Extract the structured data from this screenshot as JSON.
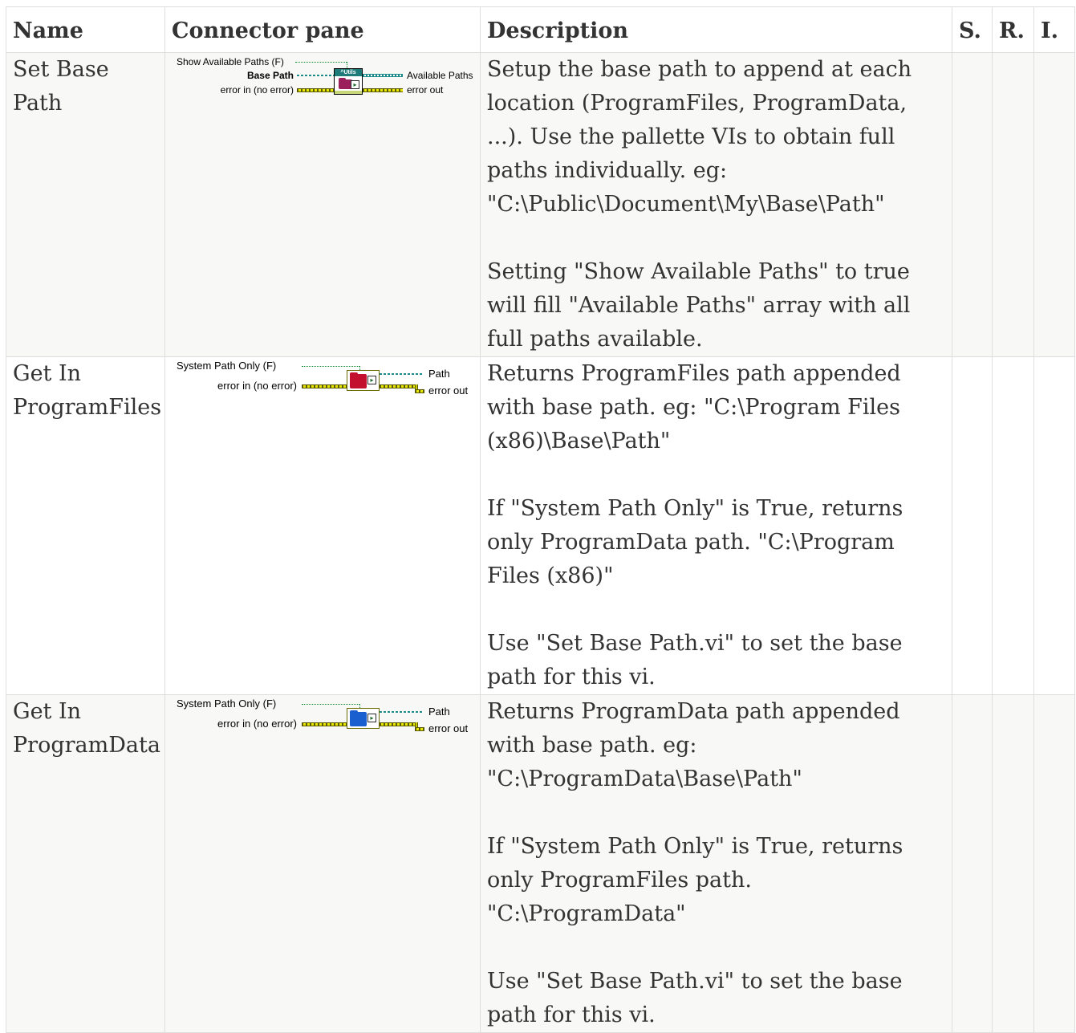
{
  "table": {
    "headers": {
      "name": "Name",
      "connector": "Connector pane",
      "description": "Description",
      "s": "S.",
      "r": "R.",
      "i": "I."
    },
    "rows": [
      {
        "name": "Set Base Path",
        "connector": {
          "icon_banner": "^Utils",
          "icon_color": "#9b1f5a",
          "inputs": [
            "Show Available Paths (F)",
            "Base Path",
            "error in (no error)"
          ],
          "outputs": [
            "Available Paths",
            "error out"
          ]
        },
        "description": {
          "p1": "Setup the base path to append at each location (ProgramFiles, ProgramData, ...). Use the pallette VIs to obtain full paths individually. eg: \"C:\\Public\\Document\\My\\Base\\Path\"",
          "p2": "Setting \"Show Available Paths\" to true will fill \"Available Paths\" array with all full paths available."
        },
        "s": "",
        "r": "",
        "i": ""
      },
      {
        "name": "Get In ProgramFiles",
        "connector": {
          "icon_color": "#c4102f",
          "inputs": [
            "System Path Only (F)",
            "error in (no error)"
          ],
          "outputs": [
            "Path",
            "error out"
          ]
        },
        "description": {
          "p1": "Returns ProgramFiles path appended with base path. eg: \"C:\\Program Files (x86)\\Base\\Path\"",
          "p2": "If \"System Path Only\" is True, returns only ProgramData path. \"C:\\Program Files (x86)\"",
          "p3": "Use \"Set Base Path.vi\" to set the base path for this vi."
        },
        "s": "",
        "r": "",
        "i": ""
      },
      {
        "name": "Get In ProgramData",
        "connector": {
          "icon_color": "#1a5fd0",
          "inputs": [
            "System Path Only (F)",
            "error in (no error)"
          ],
          "outputs": [
            "Path",
            "error out"
          ]
        },
        "description": {
          "p1": "Returns ProgramData path appended with base path. eg: \"C:\\ProgramData\\Base\\Path\"",
          "p2": "If \"System Path Only\" is True, returns only ProgramFiles path. \"C:\\ProgramData\"",
          "p3": "Use \"Set Base Path.vi\" to set the base path for this vi."
        },
        "s": "",
        "r": "",
        "i": ""
      }
    ]
  }
}
